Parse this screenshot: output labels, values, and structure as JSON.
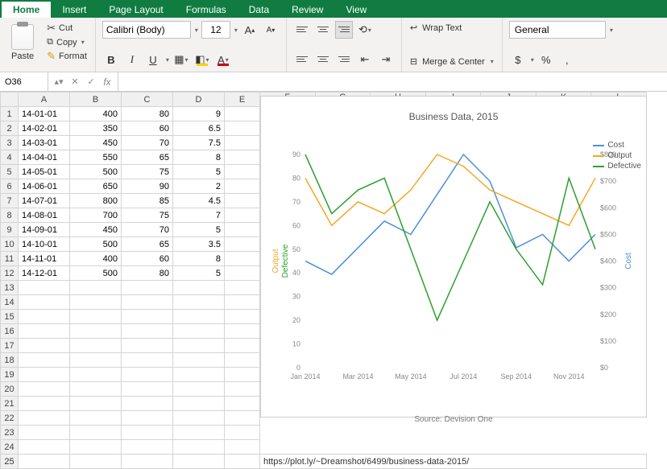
{
  "ribbon": {
    "tabs": [
      "Home",
      "Insert",
      "Page Layout",
      "Formulas",
      "Data",
      "Review",
      "View"
    ],
    "active": 0,
    "clipboard": {
      "paste": "Paste",
      "cut": "Cut",
      "copy": "Copy",
      "format": "Format"
    },
    "font": {
      "name": "Calibri (Body)",
      "size": "12",
      "bold": "B",
      "italic": "I",
      "underline": "U",
      "grow": "A",
      "shrink": "A"
    },
    "alignment": {
      "wrap": "Wrap Text",
      "merge": "Merge & Center"
    },
    "number": {
      "format": "General",
      "currency": "$",
      "percent": "%",
      "comma": ","
    }
  },
  "formula_bar": {
    "name_box": "O36",
    "fx": "fx",
    "value": ""
  },
  "columns": [
    "",
    "A",
    "B",
    "C",
    "D",
    "E"
  ],
  "rows": [
    {
      "n": 1,
      "a": "14-01-01",
      "b": "400",
      "c": "80",
      "d": "9"
    },
    {
      "n": 2,
      "a": "14-02-01",
      "b": "350",
      "c": "60",
      "d": "6.5"
    },
    {
      "n": 3,
      "a": "14-03-01",
      "b": "450",
      "c": "70",
      "d": "7.5"
    },
    {
      "n": 4,
      "a": "14-04-01",
      "b": "550",
      "c": "65",
      "d": "8"
    },
    {
      "n": 5,
      "a": "14-05-01",
      "b": "500",
      "c": "75",
      "d": "5"
    },
    {
      "n": 6,
      "a": "14-06-01",
      "b": "650",
      "c": "90",
      "d": "2"
    },
    {
      "n": 7,
      "a": "14-07-01",
      "b": "800",
      "c": "85",
      "d": "4.5"
    },
    {
      "n": 8,
      "a": "14-08-01",
      "b": "700",
      "c": "75",
      "d": "7"
    },
    {
      "n": 9,
      "a": "14-09-01",
      "b": "450",
      "c": "70",
      "d": "5"
    },
    {
      "n": 10,
      "a": "14-10-01",
      "b": "500",
      "c": "65",
      "d": "3.5"
    },
    {
      "n": 11,
      "a": "14-11-01",
      "b": "400",
      "c": "60",
      "d": "8"
    },
    {
      "n": 12,
      "a": "14-12-01",
      "b": "500",
      "c": "80",
      "d": "5"
    },
    {
      "n": 13
    },
    {
      "n": 14
    },
    {
      "n": 15
    },
    {
      "n": 16
    },
    {
      "n": 17
    },
    {
      "n": 18
    },
    {
      "n": 19
    },
    {
      "n": 20
    },
    {
      "n": 21
    },
    {
      "n": 22
    },
    {
      "n": 23
    },
    {
      "n": 24
    }
  ],
  "url_row": {
    "n": 25,
    "text": "https://plot.ly/~Dreamshot/6499/business-data-2015/"
  },
  "chart_data": {
    "type": "line",
    "title": "Business Data, 2015",
    "caption": "Source: Devision One",
    "x_ticks": [
      "Jan 2014",
      "Mar 2014",
      "May 2014",
      "Jul 2014",
      "Sep 2014",
      "Nov 2014"
    ],
    "y_left": {
      "label_primary": "Output",
      "label_secondary": "Defective",
      "min": 0,
      "max": 90,
      "ticks": [
        0,
        10,
        20,
        30,
        40,
        50,
        60,
        70,
        80,
        90
      ]
    },
    "y_right": {
      "label": "Cost",
      "min": 0,
      "max": 800,
      "ticks": [
        0,
        100,
        200,
        300,
        400,
        500,
        600,
        700,
        800
      ]
    },
    "series": [
      {
        "name": "Cost",
        "axis": "right",
        "color": "#4a90d9",
        "values": [
          400,
          350,
          450,
          550,
          500,
          650,
          800,
          700,
          450,
          500,
          400,
          500
        ]
      },
      {
        "name": "Output",
        "axis": "left_primary",
        "color": "#f5a623",
        "values": [
          80,
          60,
          70,
          65,
          75,
          90,
          85,
          75,
          70,
          65,
          60,
          80
        ]
      },
      {
        "name": "Defective",
        "axis": "left_secondary",
        "scale_max": 9,
        "color": "#2ca02c",
        "values": [
          9,
          6.5,
          7.5,
          8,
          5,
          2,
          4.5,
          7,
          5,
          3.5,
          8,
          5
        ]
      }
    ],
    "legend": [
      "Cost",
      "Output",
      "Defective"
    ]
  }
}
